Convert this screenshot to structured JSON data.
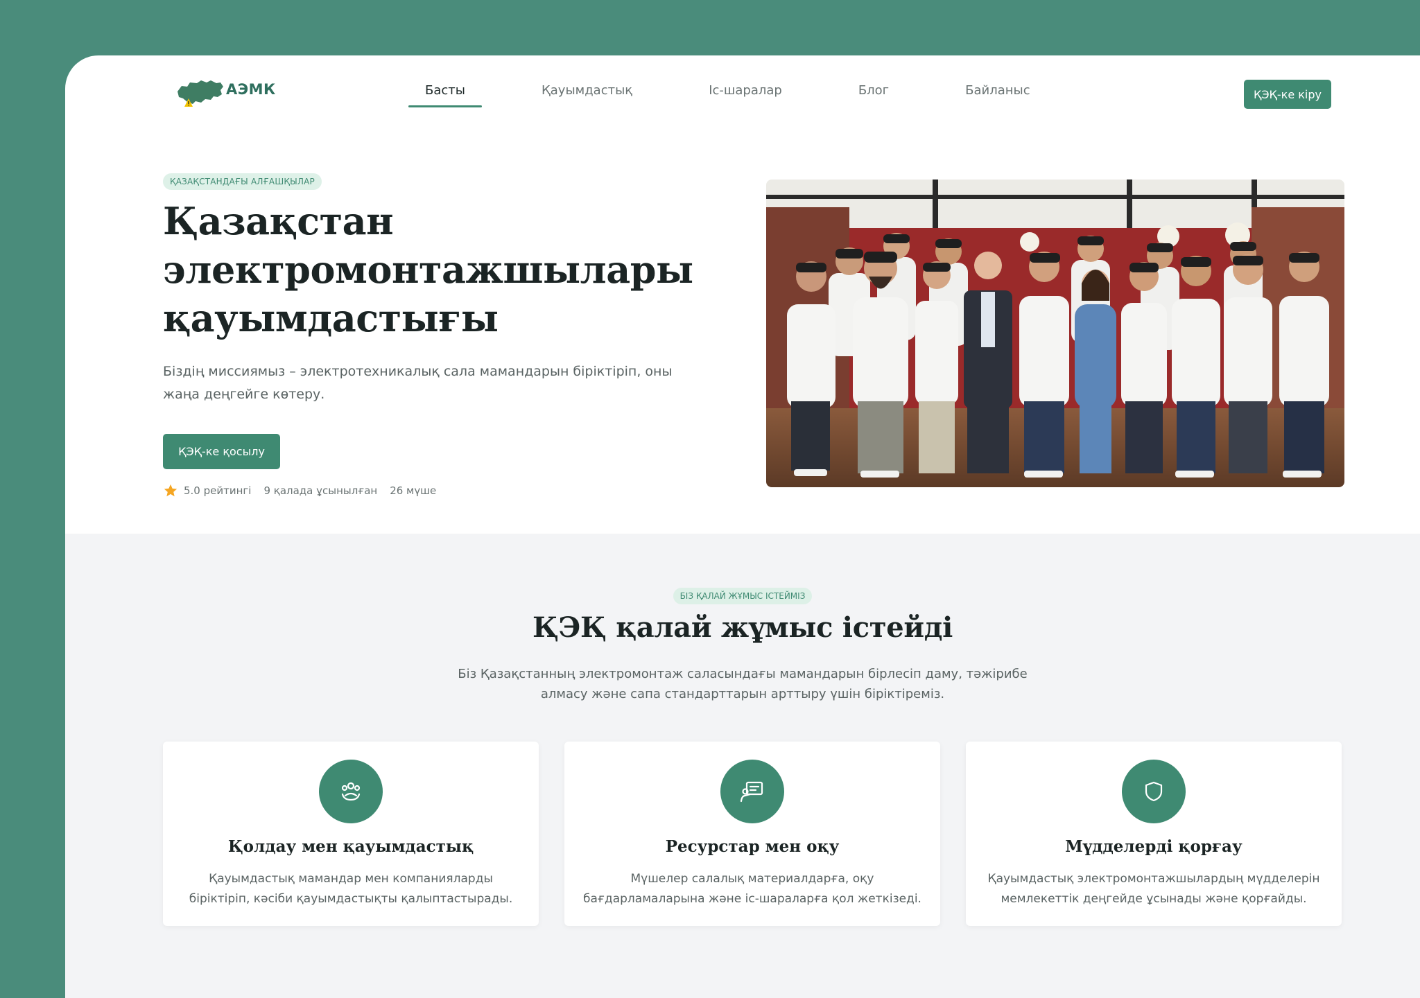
{
  "nav": {
    "logo_text": "АЭМК",
    "items": [
      {
        "label": "Басты",
        "active": true
      },
      {
        "label": "Қауымдастық",
        "active": false
      },
      {
        "label": "Іс-шаралар",
        "active": false
      },
      {
        "label": "Блог",
        "active": false
      },
      {
        "label": "Байланыс",
        "active": false
      }
    ],
    "login_label": "ҚЭҚ-ке кіру"
  },
  "hero": {
    "pill": "ҚАЗАҚСТАНДАҒЫ АЛҒАШҚЫЛАР",
    "title_lines": [
      "Қазақстан",
      "электромонтажшылары",
      "қауымдастығы"
    ],
    "subtitle": "Біздің миссиямыз – электротехникалық сала мамандарын біріктіріп, оны жаңа деңгейге көтеру.",
    "join_label": "ҚЭҚ-ке қосылу",
    "stats": {
      "rating": "5.0 рейтингі",
      "cities": "9 қалада ұсынылған",
      "members": "26 мүше"
    }
  },
  "how": {
    "pill": "БІЗ ҚАЛАЙ ЖҰМЫС ІСТЕЙМІЗ",
    "title": "ҚЭҚ қалай жұмыс істейді",
    "subtitle": "Біз Қазақстанның электромонтаж саласындағы мамандарын бірлесіп даму, тәжірибе алмасу және сапа стандарттарын арттыру үшін біріктіреміз.",
    "cards": [
      {
        "icon": "community-icon",
        "title": "Қолдау мен қауымдастық",
        "text": "Қауымдастық мамандар мен компанияларды біріктіріп, кәсіби қауымдастықты қалыптастырады."
      },
      {
        "icon": "learning-icon",
        "title": "Ресурстар мен оқу",
        "text": "Мүшелер салалық материалдарға, оқу бағдарламаларына және іс-шараларға қол жеткізеді."
      },
      {
        "icon": "shield-icon",
        "title": "Мүдделерді қорғау",
        "text": "Қауымдастық электромонтажшылардың мүдделерін мемлекеттік деңгейде ұсынады және қорғайды."
      }
    ]
  },
  "colors": {
    "brand": "#3f8a72",
    "frame_bg": "#4a8c7b",
    "section_bg": "#f3f4f6",
    "star": "#f5a623"
  }
}
